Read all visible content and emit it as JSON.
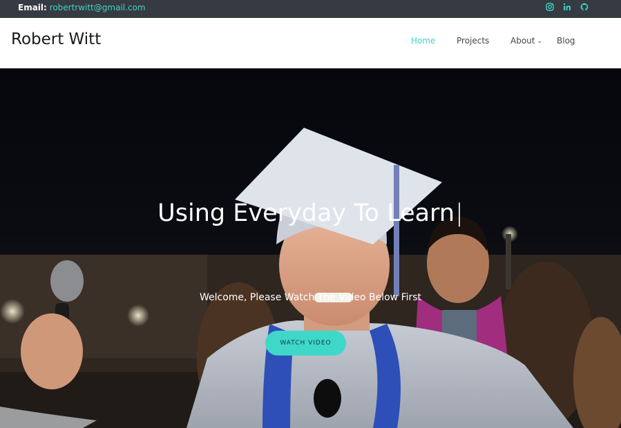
{
  "topbar": {
    "email_label": "Email:",
    "email_address": "robertrwitt@gmail.com",
    "social": [
      "instagram-icon",
      "linkedin-icon",
      "github-icon"
    ],
    "accent": "#3fd3c3",
    "background": "#363a42"
  },
  "header": {
    "logo": "Robert Witt",
    "nav": {
      "home": "Home",
      "projects": "Projects",
      "about": "About",
      "blog": "Blog"
    },
    "active_item": "Home"
  },
  "hero": {
    "title": "Using Everyday To Learn",
    "caret": "|",
    "subtitle": "Welcome, Please Watch The Video Below First",
    "button": "Watch Video",
    "button_color": "#3fd8c8"
  }
}
